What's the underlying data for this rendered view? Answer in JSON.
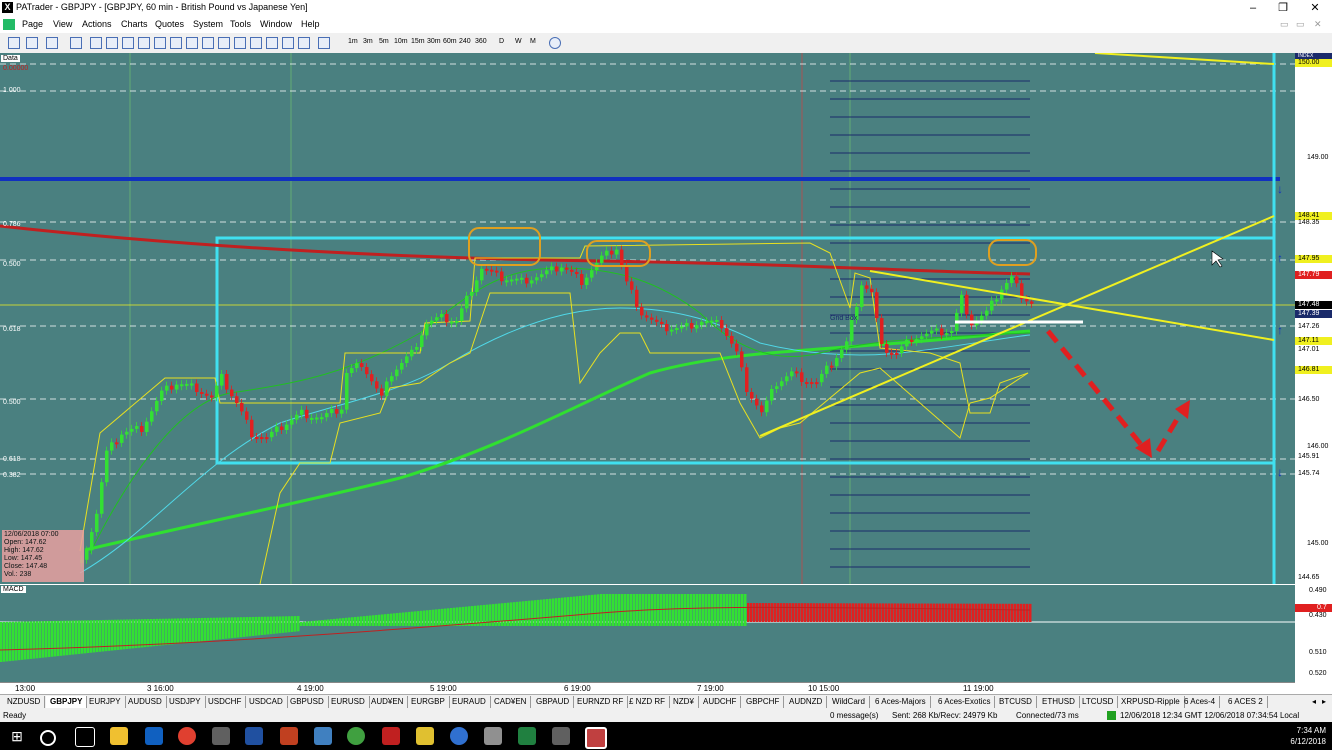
{
  "window": {
    "title": "PATrader - GBPJPY - [GBPJPY, 60 min - British Pound vs Japanese Yen]",
    "app_icon": "X"
  },
  "menu": [
    "Page",
    "View",
    "Actions",
    "Charts",
    "Quotes",
    "System",
    "Tools",
    "Window",
    "Help"
  ],
  "toolbar": {
    "timeframes": [
      "1m",
      "3m",
      "5m",
      "10m",
      "15m",
      "30m",
      "60m",
      "240",
      "360",
      "D",
      "W",
      "M"
    ]
  },
  "chart": {
    "data_label": "Data",
    "sub_label": "0.00000",
    "fib_labels": [
      "1.000",
      "0.786",
      "0.500",
      "0.618",
      "0.500",
      "0.618",
      "0.382"
    ],
    "grid_label": "Grid Box",
    "info": {
      "date": "12/06/2018 07:00",
      "open": "Open: 147.62",
      "high": "High: 147.62",
      "low": "Low: 147.45",
      "close": "Close: 147.48",
      "vol": "Vol.: 238"
    }
  },
  "price_axis": {
    "header": "INDEX",
    "labels": [
      "150.00",
      "149.00",
      "148.41",
      "148.35",
      "147.95",
      "147.79",
      "147.48",
      "147.39",
      "147.26",
      "147.11",
      "147.01",
      "146.81",
      "146.50",
      "146.00",
      "145.91",
      "145.74",
      "145.00",
      "144.65"
    ]
  },
  "macd": {
    "label": "MACD",
    "axis": [
      "0.490",
      "0.7",
      "0.430",
      "0.510",
      "0.520"
    ]
  },
  "time_axis": [
    "13:00",
    "3 16:00",
    "4 19:00",
    "5 19:00",
    "6 19:00",
    "7 19:00",
    "10 15:00",
    "11 19:00"
  ],
  "tabs": [
    "NZDUSD",
    "GBPJPY",
    "EURJPY",
    "AUDUSD",
    "USDJPY",
    "USDCHF",
    "USDCAD",
    "GBPUSD",
    "EURUSD",
    "AUD¥EN",
    "EURGBP",
    "EURAUD",
    "CAD¥EN",
    "GBPAUD",
    "EURNZD RF",
    "£ NZD RF",
    "NZD¥",
    "AUDCHF",
    "GBPCHF",
    "AUDNZD",
    "WildCard",
    "6 Aces-Majors",
    "6 Aces-Exotics",
    "BTCUSD",
    "ETHUSD",
    "LTCUSD",
    "XRPUSD-Ripple",
    "6 Aces-4",
    "6 ACES 2"
  ],
  "active_tab": "GBPJPY",
  "status": {
    "ready": "Ready",
    "messages": "0 message(s)",
    "traffic": "Sent: 268 Kb/Recv: 24979 Kb",
    "connection": "Connected/73 ms",
    "times": "12/06/2018 12:34 GMT   12/06/2018 07:34:54 Local"
  },
  "clock": {
    "time": "7:34 AM",
    "date": "6/12/2018"
  },
  "colors": {
    "chart_bg": "#4a8080",
    "bull": "#33e033",
    "bear": "#e02020",
    "trend_yellow": "#f0f020",
    "box_cyan": "#40e0f0",
    "support_blue": "#1030c0",
    "annot_orange": "#e0a020"
  },
  "icons": [
    "windows-start-icon",
    "search-icon",
    "task-view-icon",
    "file-explorer-icon",
    "outlook-icon",
    "chrome-icon",
    "word-icon",
    "powerpoint-icon",
    "excel-icon"
  ]
}
